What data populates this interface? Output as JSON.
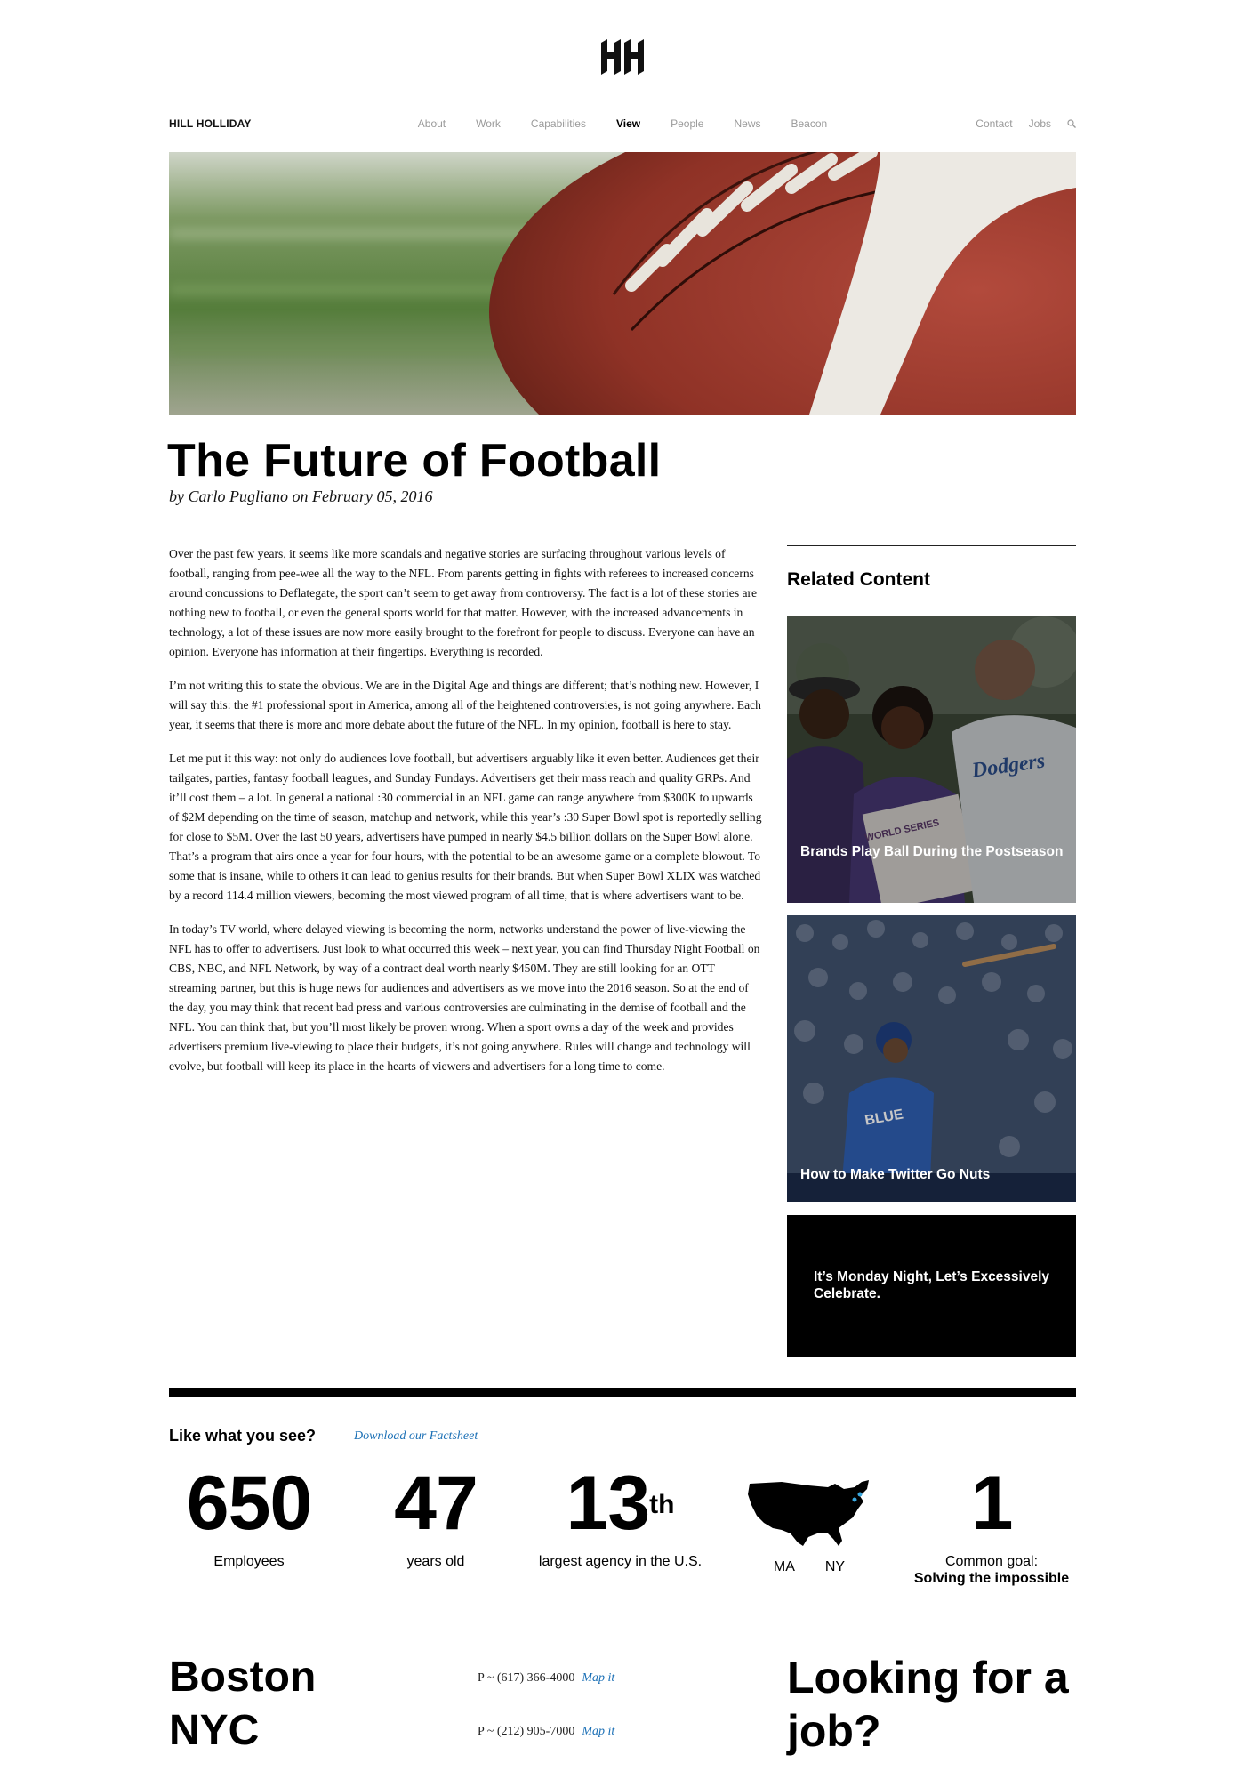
{
  "logo": {
    "icon": "hh-logo-icon"
  },
  "nav": {
    "brand": "HILL HOLLIDAY",
    "items": [
      {
        "label": "About"
      },
      {
        "label": "Work"
      },
      {
        "label": "Capabilities"
      },
      {
        "label": "View"
      },
      {
        "label": "People"
      },
      {
        "label": "News"
      },
      {
        "label": "Beacon"
      }
    ],
    "active": "View",
    "right_items": [
      {
        "label": "Contact"
      },
      {
        "label": "Jobs"
      }
    ],
    "search_icon": "search-icon"
  },
  "article": {
    "title": "The Future of Football",
    "byline": "by Carlo Pugliano on February 05, 2016",
    "paragraphs": [
      "Over the past few years, it seems like more scandals and negative stories are surfacing throughout various levels of football, ranging from pee-wee all the way to the NFL. From parents getting in fights with referees to increased concerns around concussions to Deflategate, the sport can’t seem to get away from controversy. The fact is a lot of these stories are nothing new to football, or even the general sports world for that matter. However, with the increased advancements in technology, a lot of these issues are now more easily brought to the forefront for people to discuss. Everyone can have an opinion. Everyone has information at their fingertips. Everything is recorded.",
      "I’m not writing this to state the obvious. We are in the Digital Age and things are different; that’s nothing new. However, I will say this: the #1 professional sport in America, among all of the heightened controversies, is not going anywhere. Each year, it seems that there is more and more debate about the future of the NFL. In my opinion, football is here to stay.",
      "Let me put it this way: not only do audiences love football, but advertisers arguably like it even better. Audiences get their tailgates, parties, fantasy football leagues, and Sunday Fundays. Advertisers get their mass reach and quality GRPs. And it’ll cost them – a lot. In general a national :30 commercial in an NFL game can range anywhere from $300K to upwards of $2M depending on the time of season, matchup and network, while this year’s :30 Super Bowl spot is reportedly selling for close to $5M. Over the last 50 years, advertisers have pumped in nearly $4.5 billion dollars on the Super Bowl alone. That’s a program that airs once a year for four hours, with the potential to be an awesome game or a complete blowout. To some that is insane, while to others it can lead to genius results for their brands. But when Super Bowl XLIX was watched by a record 114.4 million viewers, becoming the most viewed program of all time, that is where advertisers want to be.",
      "In today’s TV world, where delayed viewing is becoming the norm, networks understand the power of live-viewing the NFL has to offer to advertisers. Just look to what occurred this week – next year, you can find Thursday Night Football on CBS, NBC, and NFL Network, by way of a contract deal worth nearly $450M. They are still looking for an OTT streaming partner, but this is huge news for audiences and advertisers as we move into the 2016 season. So at the end of the day, you may think that recent bad press and various controversies are culminating in the demise of football and the NFL. You can think that, but you’ll most likely be proven wrong. When a sport owns a day of the week and provides advertisers premium live-viewing to place their budgets, it’s not going anywhere. Rules will change and technology will evolve, but football will keep its place in the hearts of viewers and advertisers for a long time to come."
    ]
  },
  "sidebar": {
    "heading": "Related Content",
    "cards": [
      {
        "label": "Brands Play Ball During the Postseason",
        "sign_text": "WORLD SERIES",
        "jersey_text": "Dodgers"
      },
      {
        "label": "How to Make Twitter Go Nuts",
        "jersey_text": "BLUE"
      },
      {
        "label": "It’s Monday Night, Let’s Excessively Celebrate."
      }
    ]
  },
  "stats": {
    "like_text": "Like what you see?",
    "download_link": "Download our Factsheet",
    "items": [
      {
        "value": "650",
        "label": "Employees"
      },
      {
        "value": "47",
        "label": "years old"
      },
      {
        "value": "13",
        "suffix": "th",
        "label": "largest agency in the U.S."
      },
      {
        "map_icon": "usa-map-icon",
        "labels": [
          "MA",
          "NY"
        ]
      },
      {
        "value": "1",
        "label": "Common goal:",
        "label_bold": "Solving the impossible"
      }
    ]
  },
  "footer": {
    "offices": [
      {
        "city": "Boston",
        "phone": "P ~ (617) 366-4000",
        "map_link": "Map it"
      },
      {
        "city": "NYC",
        "phone": "P ~ (212) 905-7000",
        "map_link": "Map it"
      }
    ],
    "job_text": "Looking for a job?"
  },
  "colors": {
    "link": "#1a6fb5",
    "nav_inactive": "#9a9a9a",
    "text": "#111111"
  }
}
